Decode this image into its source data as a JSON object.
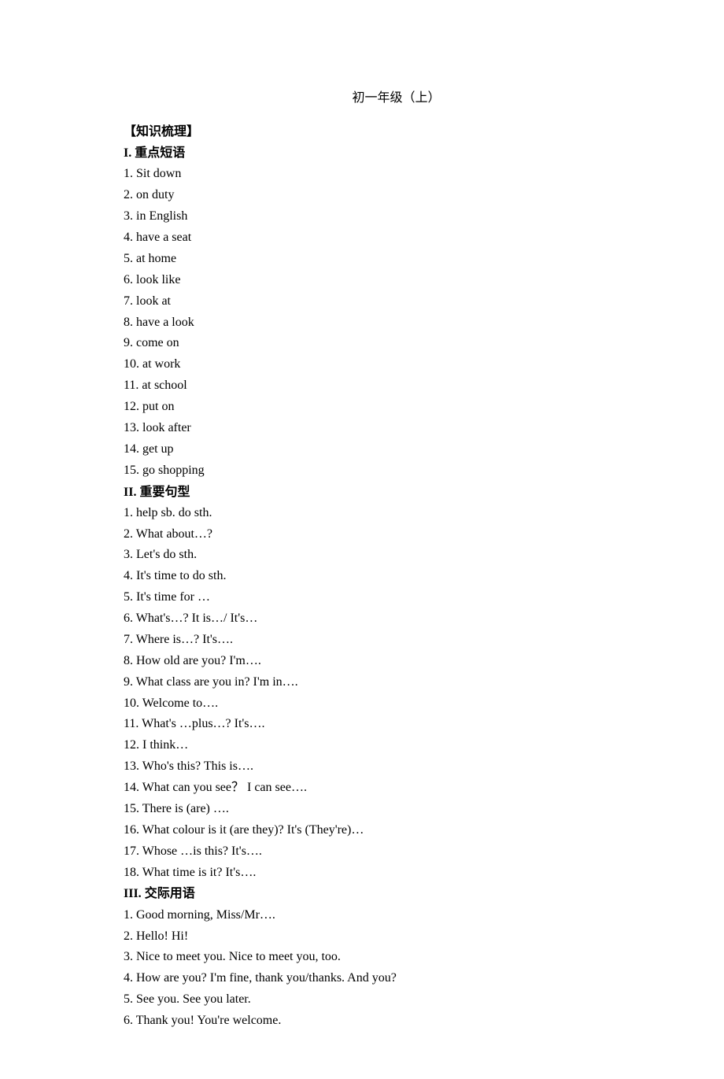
{
  "title": "初一年级（上）",
  "section_header": "【知识梳理】",
  "sections": [
    {
      "roman": "I.",
      "label": "重点短语",
      "items": [
        "1. Sit down",
        "2. on duty",
        "3. in English",
        "4. have a seat",
        "5. at home",
        "6. look like",
        "7. look at",
        "8. have a look",
        "9. come on",
        "10. at work",
        "11. at school",
        "12. put on",
        "13. look after",
        "14. get up",
        "15. go shopping"
      ]
    },
    {
      "roman": "II.",
      "label": "重要句型",
      "items": [
        "1. help sb. do sth.",
        "2. What about…?",
        "3. Let's do sth.",
        "4. It's time to do sth.",
        "5. It's time for …",
        "6. What's…? It is…/ It's…",
        "7. Where is…? It's….",
        "8. How old are you? I'm….",
        "9. What class are you in? I'm in….",
        "10. Welcome to….",
        "11. What's …plus…? It's….",
        "12. I think…",
        "13. Who's this? This is….",
        "14. What can you see？  I can see….",
        "15. There is (are) ….",
        "16. What colour is it (are they)? It's (They're)…",
        "17. Whose …is this? It's….",
        "18. What time is it? It's…."
      ]
    },
    {
      "roman": "III.",
      "label": "交际用语",
      "items": [
        "1. Good morning, Miss/Mr….",
        "2. Hello! Hi!",
        "3. Nice to meet you. Nice to meet you, too.",
        "4. How are you? I'm fine, thank you/thanks. And you?",
        "5. See you. See you later.",
        "6. Thank you! You're welcome."
      ]
    }
  ]
}
